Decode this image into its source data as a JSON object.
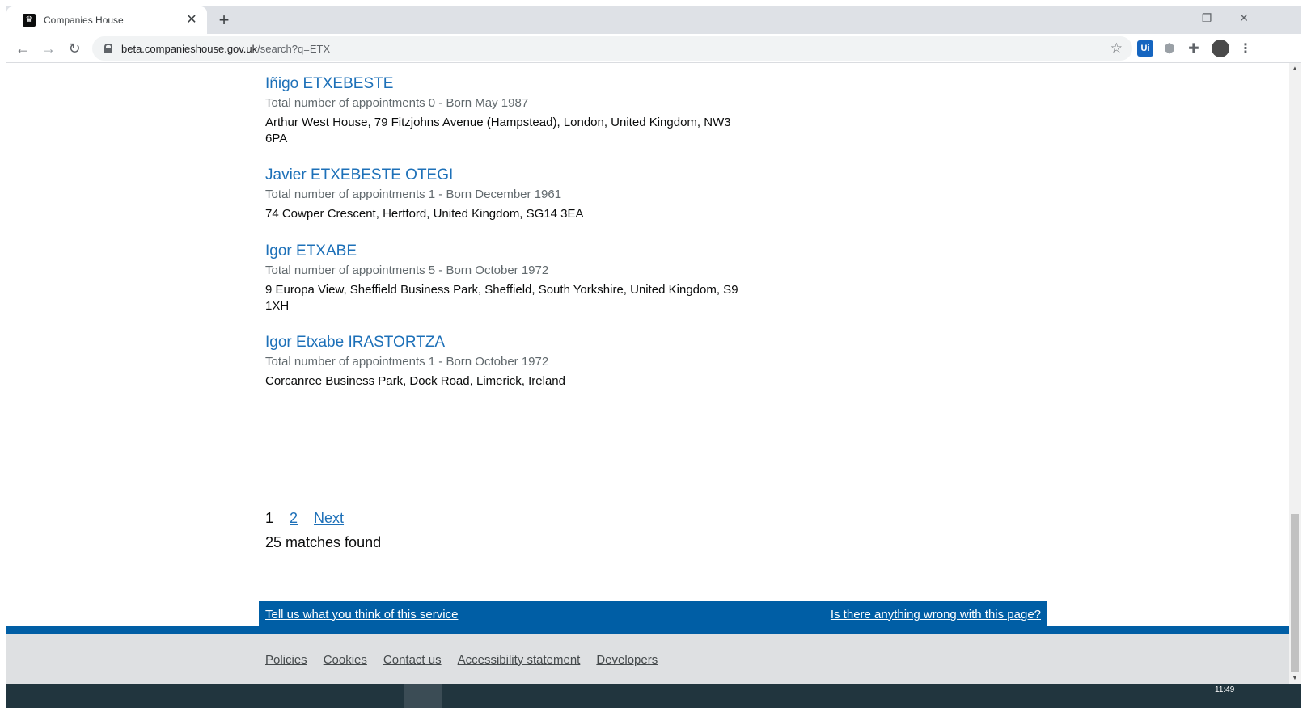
{
  "browser": {
    "tab_title": "Companies House",
    "favicon_glyph": "♛",
    "url_host": "beta.companieshouse.gov.uk",
    "url_path": "/search?q=ETX",
    "extensions": [
      "Ui",
      "",
      "",
      ""
    ]
  },
  "results": [
    {
      "name": "Iñigo ETXEBESTE",
      "meta": "Total number of appointments 0 - Born May 1987",
      "address": "Arthur West House, 79 Fitzjohns Avenue (Hampstead), London, United Kingdom, NW3 6PA"
    },
    {
      "name": "Javier ETXEBESTE OTEGI",
      "meta": "Total number of appointments 1 - Born December 1961",
      "address": "74 Cowper Crescent, Hertford, United Kingdom, SG14 3EA"
    },
    {
      "name": "Igor ETXABE",
      "meta": "Total number of appointments 5 - Born October 1972",
      "address": "9 Europa View, Sheffield Business Park, Sheffield, South Yorkshire, United Kingdom, S9 1XH"
    },
    {
      "name": "Igor Etxabe IRASTORTZA",
      "meta": "Total number of appointments 1 - Born October 1972",
      "address": "Corcanree Business Park, Dock Road, Limerick, Ireland"
    }
  ],
  "pagination": {
    "current": "1",
    "page2": "2",
    "next": "Next",
    "matches": "25 matches found"
  },
  "feedback": {
    "left": "Tell us what you think of this service",
    "right": "Is there anything wrong with this page?"
  },
  "footer": {
    "links": [
      "Policies",
      "Cookies",
      "Contact us",
      "Accessibility statement",
      "Developers"
    ]
  },
  "taskbar": {
    "clock": "11:49"
  },
  "colors": {
    "link": "#1d70b8",
    "brand_blue": "#005ea5",
    "footer_bg": "#dee0e2"
  }
}
